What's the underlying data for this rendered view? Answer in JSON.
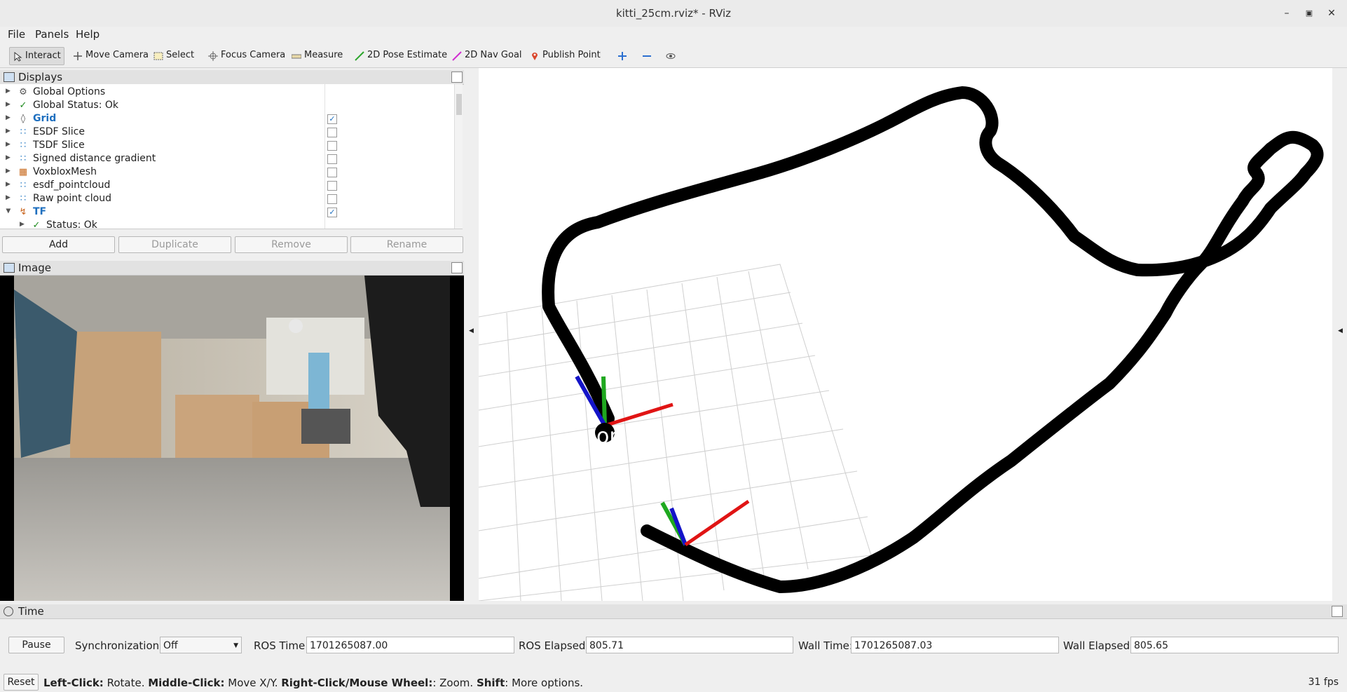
{
  "window": {
    "title": "kitti_25cm.rviz* - RViz",
    "minimize_icon": "minimize-icon",
    "maximize_icon": "maximize-icon",
    "close_icon": "close-icon"
  },
  "menu": [
    "File",
    "Panels",
    "Help"
  ],
  "toolbar": {
    "interact": "Interact",
    "move_camera": "Move Camera",
    "select": "Select",
    "focus_camera": "Focus Camera",
    "measure": "Measure",
    "pose_estimate": "2D Pose Estimate",
    "nav_goal": "2D Nav Goal",
    "publish_point": "Publish Point"
  },
  "displays": {
    "title": "Displays",
    "items": [
      {
        "label": "Global Options",
        "icon": "gear-icon",
        "checked": null
      },
      {
        "label": "Global Status: Ok",
        "icon": "check-icon",
        "checked": null
      },
      {
        "label": "Grid",
        "icon": "grid-icon",
        "checked": true
      },
      {
        "label": "ESDF Slice",
        "icon": "pointcloud-icon",
        "checked": false
      },
      {
        "label": "TSDF Slice",
        "icon": "pointcloud-icon",
        "checked": false
      },
      {
        "label": "Signed distance gradient",
        "icon": "pointcloud-icon",
        "checked": false
      },
      {
        "label": "VoxbloxMesh",
        "icon": "mesh-icon",
        "checked": false
      },
      {
        "label": "esdf_pointcloud",
        "icon": "pointcloud-icon",
        "checked": false
      },
      {
        "label": "Raw point cloud",
        "icon": "pointcloud-icon",
        "checked": false
      },
      {
        "label": "TF",
        "icon": "tf-icon",
        "checked": true
      },
      {
        "label": "Status: Ok",
        "icon": "check-icon",
        "checked": null
      }
    ],
    "buttons": {
      "add": "Add",
      "duplicate": "Duplicate",
      "remove": "Remove",
      "rename": "Rename"
    }
  },
  "image_panel": {
    "title": "Image"
  },
  "viewport": {
    "frame_label": "orl"
  },
  "time_panel": {
    "title": "Time",
    "pause": "Pause",
    "sync_label": "Synchronization:",
    "sync_value": "Off",
    "ros_time_label": "ROS Time:",
    "ros_time": "1701265087.00",
    "ros_elapsed_label": "ROS Elapsed:",
    "ros_elapsed": "805.71",
    "wall_time_label": "Wall Time:",
    "wall_time": "1701265087.03",
    "wall_elapsed_label": "Wall Elapsed:",
    "wall_elapsed": "805.65"
  },
  "statusbar": {
    "reset": "Reset",
    "left_click": "Left-Click:",
    "left_desc": " Rotate. ",
    "middle_click": "Middle-Click:",
    "middle_desc": " Move X/Y. ",
    "right_click": "Right-Click/Mouse Wheel:",
    "right_desc": ": Zoom. ",
    "shift": "Shift",
    "shift_desc": ": More options.",
    "fps": "31 fps"
  }
}
